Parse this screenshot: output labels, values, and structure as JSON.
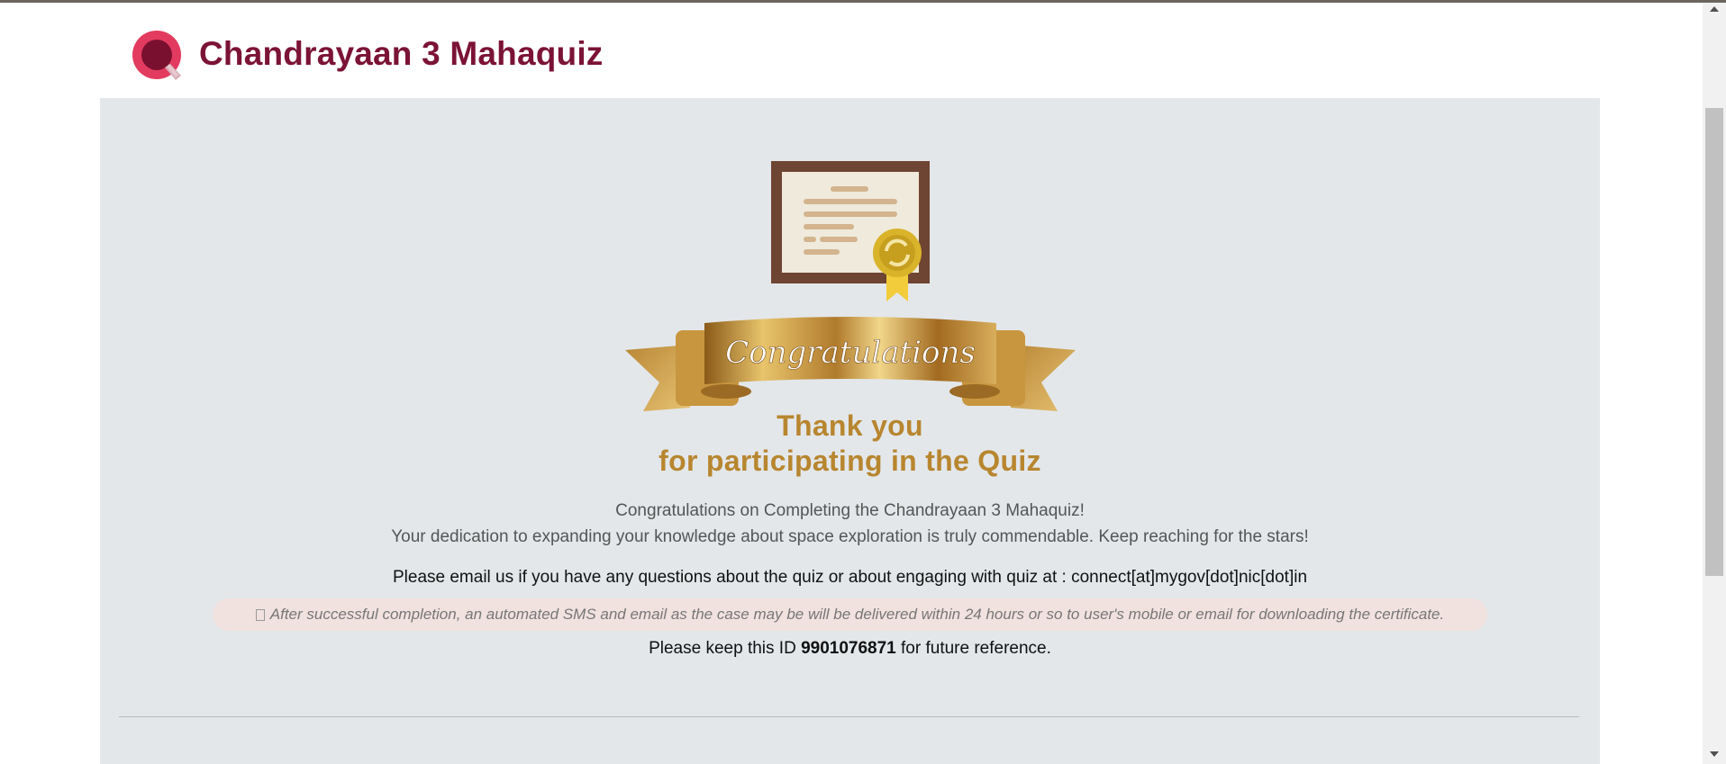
{
  "header": {
    "title": "Chandrayaan 3 Mahaquiz",
    "logo_icon": "quiz-q-logo-icon",
    "brand_color": "#7b1336"
  },
  "main": {
    "banner_text": "Congratulations",
    "thanks_line1": "Thank you",
    "thanks_line2": "for participating in the Quiz",
    "congrats_line1": "Congratulations on Completing the Chandrayaan 3 Mahaquiz!",
    "congrats_line2": "Your dedication to expanding your knowledge about space exploration is truly commendable. Keep reaching for the stars!",
    "email_text": "Please email us if you have any questions about the quiz or about engaging with quiz at : connect[at]mygov[dot]nic[dot]in",
    "notice_text": "After successful completion, an automated SMS and email as the case may be will be delivered within 24 hours or so to user's mobile or email for downloading the certificate.",
    "id_prefix": "Please keep this ID ",
    "id_value": "9901076871",
    "id_suffix": " for future reference."
  },
  "colors": {
    "panel_bg": "#e3e7ea",
    "gold": "#b8862f",
    "notice_bg": "#f1e2df"
  }
}
